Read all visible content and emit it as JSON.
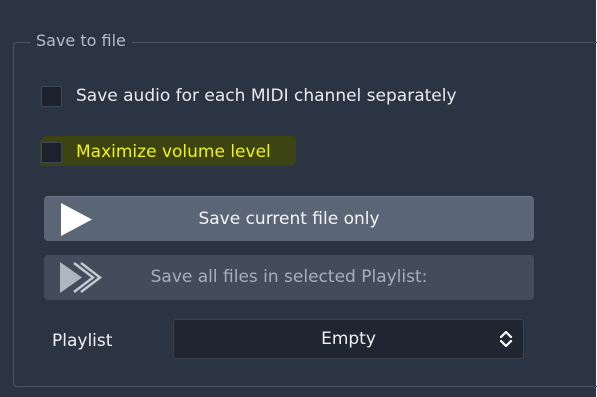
{
  "group": {
    "title": "Save to file"
  },
  "options": {
    "separate_channels_label": "Save audio for each MIDI channel separately",
    "separate_channels_checked": false,
    "maximize_volume_label": "Maximize volume level",
    "maximize_volume_checked": false
  },
  "buttons": {
    "save_current_label": "Save current file only",
    "save_current_icon": "play-icon",
    "save_all_label": "Save all files in selected Playlist:",
    "save_all_icon": "fast-forward-icon"
  },
  "playlist": {
    "label": "Playlist",
    "selected_value": "Empty",
    "arrows_icon": "chevron-up-down-icon"
  },
  "colors": {
    "window_bg": "#2b3442",
    "primary_button": "#5a6675",
    "secondary_button": "#424c5a",
    "highlight_text": "#f3f311"
  }
}
